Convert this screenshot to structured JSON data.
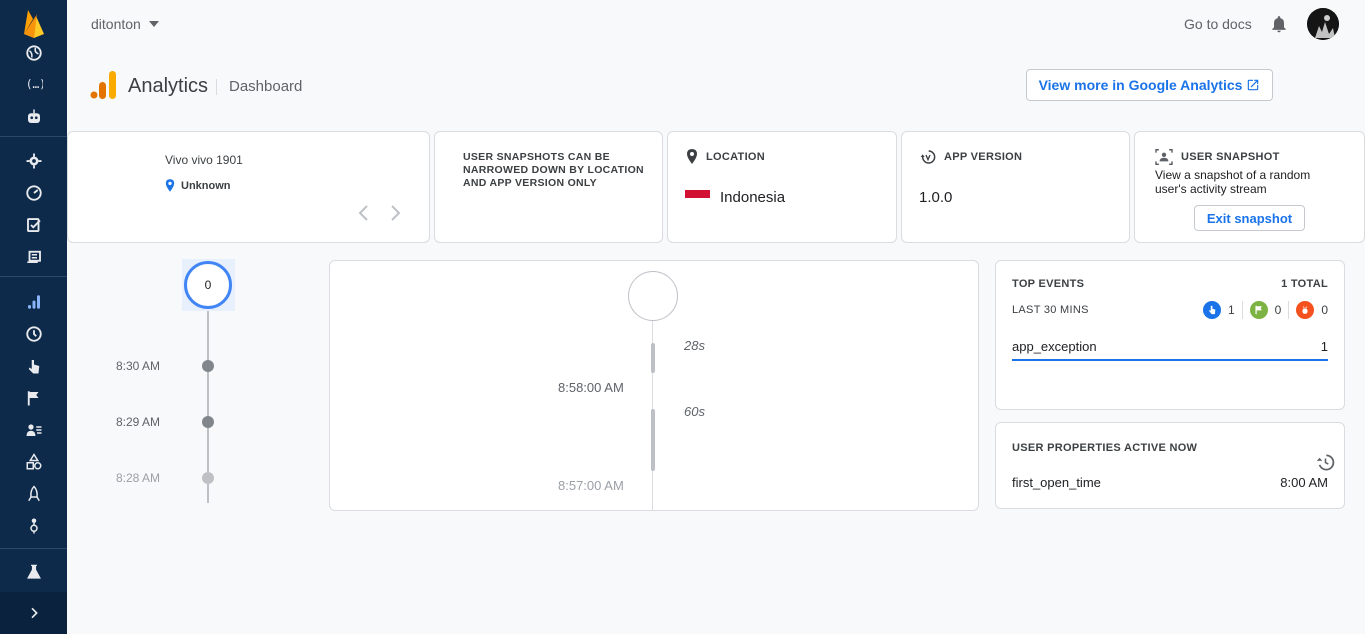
{
  "topbar": {
    "project": "ditonton",
    "docs_link": "Go to docs"
  },
  "header": {
    "title": "Analytics",
    "subtitle": "Dashboard",
    "ga_button": "View more in Google Analytics"
  },
  "device": {
    "name": "Vivo vivo 1901",
    "location": "Unknown"
  },
  "note": "USER SNAPSHOTS CAN BE NARROWED DOWN BY LOCATION AND APP VERSION ONLY",
  "location_card": {
    "label": "LOCATION",
    "value": "Indonesia"
  },
  "version_card": {
    "label": "APP VERSION",
    "value": "1.0.0"
  },
  "snapshot_card": {
    "label": "USER SNAPSHOT",
    "desc": "View a snapshot of a random user's activity stream",
    "exit": "Exit snapshot"
  },
  "timeline": {
    "count": "0",
    "times": [
      "8:30 AM",
      "8:29 AM",
      "8:28 AM"
    ]
  },
  "stream": {
    "durations": [
      "28s",
      "60s"
    ],
    "times": [
      "8:58:00 AM",
      "8:57:00 AM"
    ]
  },
  "top_events": {
    "title": "TOP EVENTS",
    "total": "1 TOTAL",
    "range": "LAST 30 MINS",
    "counts": [
      "1",
      "0",
      "0"
    ],
    "event_name": "app_exception",
    "event_count": "1"
  },
  "user_props": {
    "title": "USER PROPERTIES ACTIVE NOW",
    "name": "first_open_time",
    "value": "8:00 AM"
  },
  "colors": {
    "rail": "#0d2a4a",
    "accent": "#1a73e8",
    "flag_red": "#d21034"
  }
}
